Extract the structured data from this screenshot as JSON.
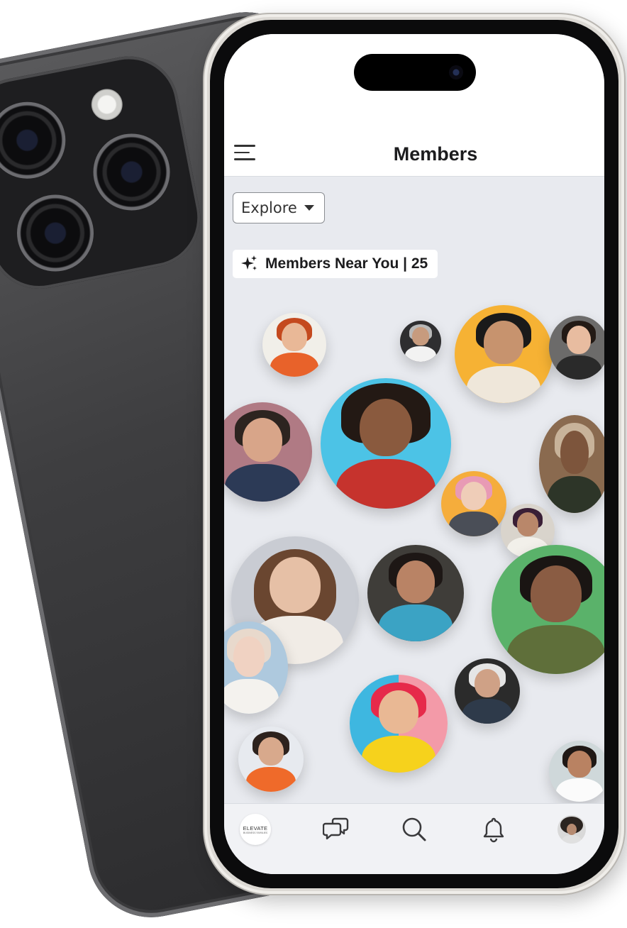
{
  "header": {
    "title": "Members"
  },
  "filter": {
    "dropdown_label": "Explore"
  },
  "nearby": {
    "label": "Members Near You | 25"
  },
  "logo": {
    "main": "ELEVATE",
    "sub": "BUSINESS FAMILIES"
  },
  "tabs": [
    {
      "name": "home-logo"
    },
    {
      "name": "messages",
      "icon": "chat-bubbles-icon"
    },
    {
      "name": "search",
      "icon": "search-icon"
    },
    {
      "name": "notifications",
      "icon": "bell-icon"
    },
    {
      "name": "profile",
      "icon": "avatar"
    }
  ],
  "colors": {
    "screen_bg": "#e8eaef",
    "header_bg": "#ffffff",
    "tabbar_bg": "#f1f2f5",
    "text_dark": "#1c1c1e"
  }
}
